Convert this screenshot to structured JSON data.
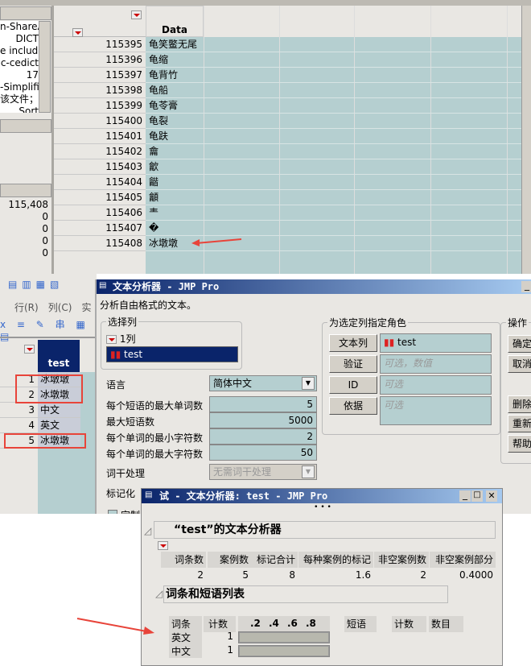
{
  "left_panel": {
    "list_lines": [
      "n-ShareA",
      "DICT",
      "e include",
      "c-cedict",
      "17",
      "-Simplifi",
      "该文件；",
      "Sort"
    ],
    "counts": [
      "115,408",
      "0",
      "0",
      "0",
      "0"
    ]
  },
  "grid": {
    "column_header": "Data",
    "rows": [
      {
        "n": "115395",
        "v": "龟笑鳖无尾"
      },
      {
        "n": "115396",
        "v": "龟缩"
      },
      {
        "n": "115397",
        "v": "龟背竹"
      },
      {
        "n": "115398",
        "v": "龟船"
      },
      {
        "n": "115399",
        "v": "龟苓膏"
      },
      {
        "n": "115400",
        "v": "龟裂"
      },
      {
        "n": "115401",
        "v": "龟趺"
      },
      {
        "n": "115402",
        "v": "龠"
      },
      {
        "n": "115403",
        "v": "龡"
      },
      {
        "n": "115404",
        "v": "龤"
      },
      {
        "n": "115405",
        "v": "龥"
      },
      {
        "n": "115406",
        "v": "龶"
      },
      {
        "n": "115407",
        "v": "�"
      },
      {
        "n": "115408",
        "v": "冰墩墩"
      }
    ]
  },
  "table2": {
    "menu": [
      "行(R)",
      "列(C)",
      "实"
    ],
    "column_header": "test",
    "rows": [
      {
        "n": "1",
        "v": "冰墩墩"
      },
      {
        "n": "2",
        "v": "冰墩墩"
      },
      {
        "n": "3",
        "v": "中文"
      },
      {
        "n": "4",
        "v": "英文"
      },
      {
        "n": "5",
        "v": "冰墩墩"
      }
    ]
  },
  "dialog": {
    "title": "文本分析器 - JMP Pro",
    "description": "分析自由格式的文本。",
    "select_columns": {
      "legend": "选择列",
      "count": "1列",
      "items": [
        "test"
      ]
    },
    "options": [
      {
        "label": "语言",
        "value": "简体中文"
      },
      {
        "label": "每个短语的最大单词数",
        "value": "5"
      },
      {
        "label": "最大短语数",
        "value": "5000"
      },
      {
        "label": "每个单词的最小字符数",
        "value": "2"
      },
      {
        "label": "每个单词的最大字符数",
        "value": "50"
      },
      {
        "label": "词干处理",
        "value": "无需词干处理"
      },
      {
        "label": "标记化"
      }
    ],
    "custom_checkbox": "定制",
    "roles": {
      "legend": "为选定列指定角色",
      "items": [
        {
          "button": "文本列",
          "value": "test"
        },
        {
          "button": "验证",
          "placeholder": "可选，数值"
        },
        {
          "button": "ID",
          "placeholder": "可选"
        },
        {
          "button": "依据",
          "placeholder": "可选"
        }
      ]
    },
    "actions": {
      "legend": "操作",
      "buttons": [
        "确定",
        "取消",
        "删除",
        "重新调用",
        "帮助"
      ]
    }
  },
  "report": {
    "title": "试 - 文本分析器: test - JMP Pro",
    "heading": "“test”的文本分析器",
    "summary": {
      "headers": [
        "词条数",
        "案例数",
        "标记合计",
        "每种案例的标记",
        "非空案例数",
        "非空案例部分"
      ],
      "values": [
        "2",
        "5",
        "8",
        "1.6",
        "2",
        "0.4000"
      ]
    },
    "list_heading": "词条和短语列表",
    "terms": {
      "headers": [
        "词条",
        "计数"
      ],
      "axis_ticks": [
        ".2",
        ".4",
        ".6",
        ".8"
      ],
      "rows": [
        {
          "term": "英文",
          "count": "1",
          "fraction": 1.0
        },
        {
          "term": "中文",
          "count": "1",
          "fraction": 1.0
        }
      ]
    },
    "phrases": {
      "headers": [
        "短语",
        "计数",
        "数目"
      ]
    }
  }
}
